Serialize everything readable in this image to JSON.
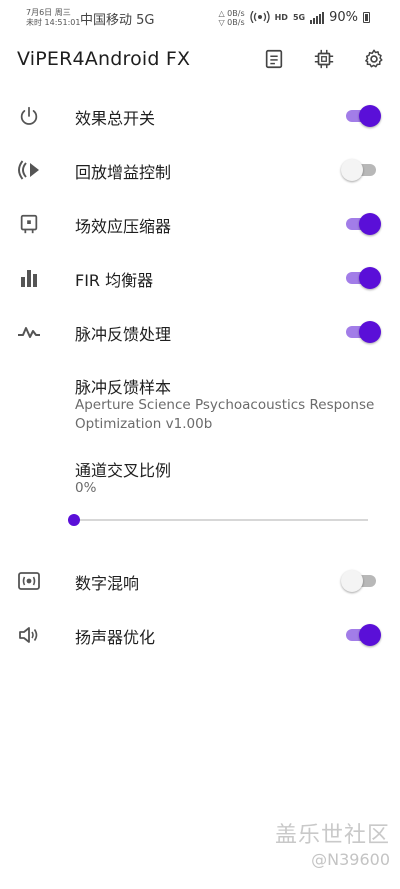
{
  "status_bar": {
    "date": "7月6日 周三",
    "time": "未时 14:51:01",
    "carrier": "中国移动 5G",
    "upload_speed": "△ 0B/s",
    "download_speed": "▽ 0B/s",
    "hd_label": "HD",
    "network": "5G",
    "battery": "90%"
  },
  "app_bar": {
    "title": "ViPER4Android FX"
  },
  "items": [
    {
      "title": "效果总开关",
      "icon": "power-icon",
      "switch_on": true
    },
    {
      "title": "回放增益控制",
      "icon": "playback-gain-icon",
      "switch_on": false
    },
    {
      "title": "场效应压缩器",
      "icon": "compressor-icon",
      "switch_on": true
    },
    {
      "title": "FIR 均衡器",
      "icon": "equalizer-icon",
      "switch_on": true
    },
    {
      "title": "脉冲反馈处理",
      "icon": "pulse-icon",
      "switch_on": true
    }
  ],
  "impulse_sample": {
    "title": "脉冲反馈样本",
    "value": "Aperture Science Psychoacoustics Response Optimization v1.00b"
  },
  "channel_cross": {
    "title": "通道交叉比例",
    "value": "0%",
    "level": 0
  },
  "bottom_items": [
    {
      "title": "数字混响",
      "icon": "reverb-icon",
      "switch_on": false
    },
    {
      "title": "扬声器优化",
      "icon": "speaker-icon",
      "switch_on": true
    }
  ],
  "colors": {
    "accent": "#5a0fd8",
    "accent_track": "#a27de8",
    "off_track": "#b8b8b8",
    "icon": "#555555"
  },
  "watermark": {
    "brand": "盖乐世社区",
    "user": "@N39600"
  }
}
